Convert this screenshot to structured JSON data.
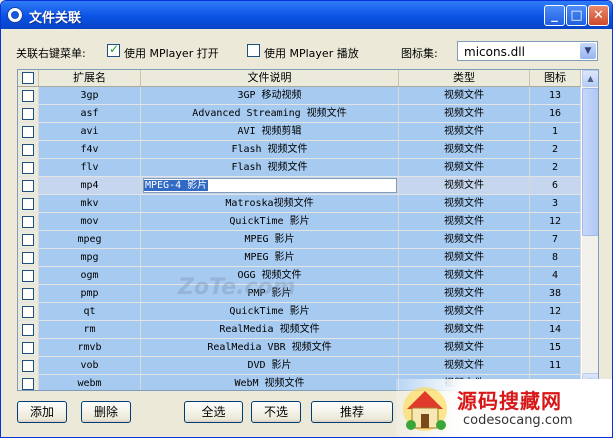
{
  "window": {
    "title": "文件关联"
  },
  "options": {
    "menu_label": "关联右键菜单:",
    "open_with": {
      "label": "使用 MPlayer 打开",
      "checked": true
    },
    "play_with": {
      "label": "使用 MPlayer 播放",
      "checked": false
    },
    "iconset_label": "图标集:",
    "iconset_value": "micons.dll"
  },
  "table": {
    "columns": [
      "扩展名",
      "文件说明",
      "类型",
      "图标"
    ],
    "editing_row": 5,
    "rows": [
      {
        "ext": "3gp",
        "desc": "3GP 移动视频",
        "type": "视频文件",
        "icon": "13"
      },
      {
        "ext": "asf",
        "desc": "Advanced Streaming 视频文件",
        "type": "视频文件",
        "icon": "16"
      },
      {
        "ext": "avi",
        "desc": "AVI 视频剪辑",
        "type": "视频文件",
        "icon": "1"
      },
      {
        "ext": "f4v",
        "desc": "Flash 视频文件",
        "type": "视频文件",
        "icon": "2"
      },
      {
        "ext": "flv",
        "desc": "Flash 视频文件",
        "type": "视频文件",
        "icon": "2"
      },
      {
        "ext": "mp4",
        "desc": "MPEG-4 影片",
        "type": "视频文件",
        "icon": "6"
      },
      {
        "ext": "mkv",
        "desc": "Matroska视频文件",
        "type": "视频文件",
        "icon": "3"
      },
      {
        "ext": "mov",
        "desc": "QuickTime 影片",
        "type": "视频文件",
        "icon": "12"
      },
      {
        "ext": "mpeg",
        "desc": "MPEG 影片",
        "type": "视频文件",
        "icon": "7"
      },
      {
        "ext": "mpg",
        "desc": "MPEG 影片",
        "type": "视频文件",
        "icon": "8"
      },
      {
        "ext": "ogm",
        "desc": "OGG 视频文件",
        "type": "视频文件",
        "icon": "4"
      },
      {
        "ext": "pmp",
        "desc": "PMP 影片",
        "type": "视频文件",
        "icon": "38"
      },
      {
        "ext": "qt",
        "desc": "QuickTime 影片",
        "type": "视频文件",
        "icon": "12"
      },
      {
        "ext": "rm",
        "desc": "RealMedia 视频文件",
        "type": "视频文件",
        "icon": "14"
      },
      {
        "ext": "rmvb",
        "desc": "RealMedia VBR 视频文件",
        "type": "视频文件",
        "icon": "15"
      },
      {
        "ext": "vob",
        "desc": "DVD 影片",
        "type": "视频文件",
        "icon": "11"
      },
      {
        "ext": "webm",
        "desc": "WebM 视频文件",
        "type": "视频文件",
        "icon": ""
      }
    ]
  },
  "buttons": {
    "add": "添加",
    "delete": "删除",
    "select_all": "全选",
    "select_none": "不选",
    "recommend": "推荐"
  },
  "watermark": {
    "site": "ZoTe.com",
    "logo_cn": "源码搜藏网",
    "logo_en": "codesocang.com"
  },
  "colors": {
    "titlebar": "#0a52e5",
    "row_bg": "#a6caf0",
    "selection": "#316ac5",
    "logo_red": "#d81818"
  }
}
